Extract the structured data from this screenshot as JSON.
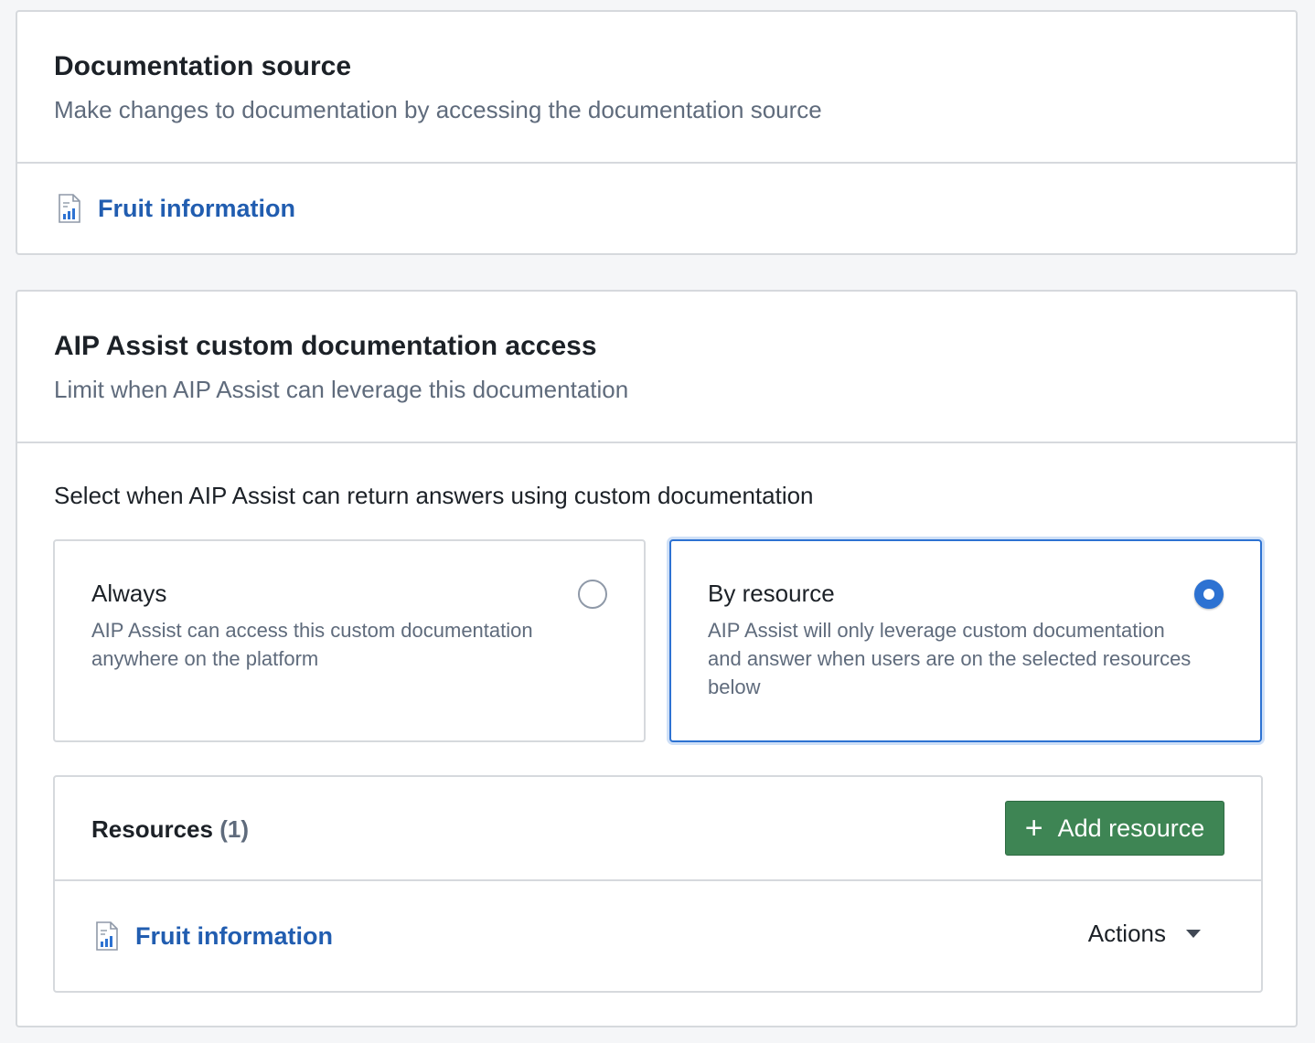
{
  "source_card": {
    "title": "Documentation source",
    "subtitle": "Make changes to documentation by accessing the documentation source",
    "resource": {
      "label": "Fruit information",
      "icon": "document-chart-icon"
    }
  },
  "access_card": {
    "title": "AIP Assist custom documentation access",
    "subtitle": "Limit when AIP Assist can leverage this documentation",
    "select_label": "Select when AIP Assist can return answers using custom documentation",
    "options": [
      {
        "title": "Always",
        "description": "AIP Assist can access this custom documentation anywhere on the platform",
        "selected": false
      },
      {
        "title": "By resource",
        "description": "AIP Assist will only leverage custom documentation and answer when users are on the selected resources below",
        "selected": true
      }
    ],
    "resources": {
      "title": "Resources",
      "count": "(1)",
      "add_button": "Add resource",
      "items": [
        {
          "label": "Fruit information",
          "icon": "document-chart-icon",
          "actions_label": "Actions"
        }
      ]
    }
  },
  "colors": {
    "link": "#215db0",
    "accent": "#2d72d2",
    "success": "#3e8554",
    "muted_text": "#5f6b7c"
  }
}
